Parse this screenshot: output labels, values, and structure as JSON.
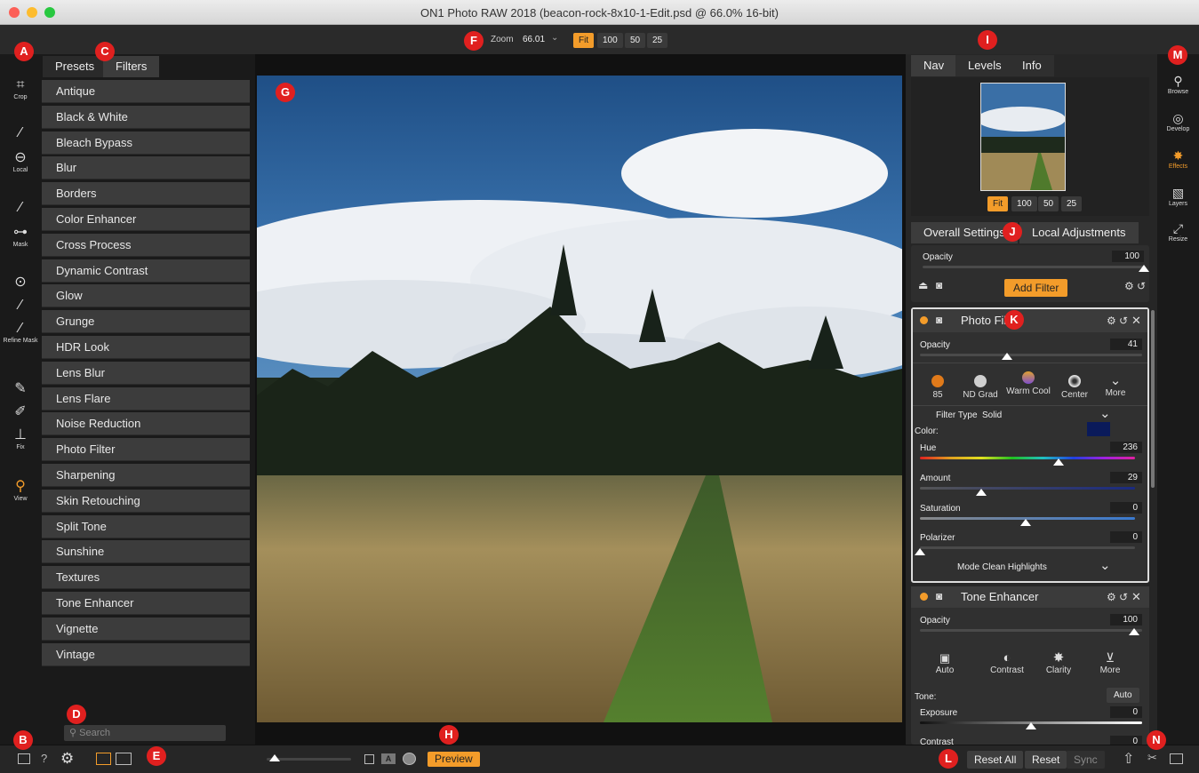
{
  "window": {
    "title": "ON1 Photo RAW 2018 (beacon-rock-8x10-1-Edit.psd @ 66.0% 16-bit)"
  },
  "toolbar": {
    "zoom_label": "Zoom",
    "zoom_value": "66.01",
    "zoom_buttons": [
      "Fit",
      "100",
      "50",
      "25"
    ],
    "active_zoom": "Fit"
  },
  "badges": [
    "A",
    "B",
    "C",
    "D",
    "E",
    "F",
    "G",
    "H",
    "I",
    "J",
    "K",
    "L",
    "M",
    "N"
  ],
  "left_tools": [
    {
      "icon": "crop-icon",
      "glyph": "⌗",
      "label": "Crop"
    },
    {
      "icon": "brush-icon",
      "glyph": "⁄",
      "label": ""
    },
    {
      "icon": "gradient-icon",
      "glyph": "⊖",
      "label": "Local"
    },
    {
      "icon": "masking-brush-icon",
      "glyph": "⁄",
      "label": ""
    },
    {
      "icon": "mask-gradient-icon",
      "glyph": "⊶",
      "label": "Mask"
    },
    {
      "icon": "masking-bug-icon",
      "glyph": "⊙",
      "label": ""
    },
    {
      "icon": "refine-brush-icon",
      "glyph": "⁄",
      "label": ""
    },
    {
      "icon": "chisel-icon",
      "glyph": "⁄",
      "label": "Refine Mask"
    },
    {
      "icon": "retouch-icon",
      "glyph": "✎",
      "label": ""
    },
    {
      "icon": "clone-icon",
      "glyph": "✐",
      "label": ""
    },
    {
      "icon": "stamp-icon",
      "glyph": "⊥",
      "label": "Fix"
    },
    {
      "icon": "zoom-icon",
      "glyph": "⚲",
      "label": "View"
    }
  ],
  "left_panel": {
    "tabs": [
      "Presets",
      "Filters"
    ],
    "active_tab": "Filters",
    "filters": [
      "Antique",
      "Black & White",
      "Bleach Bypass",
      "Blur",
      "Borders",
      "Color Enhancer",
      "Cross Process",
      "Dynamic Contrast",
      "Glow",
      "Grunge",
      "HDR Look",
      "Lens Blur",
      "Lens Flare",
      "Noise Reduction",
      "Photo Filter",
      "Sharpening",
      "Skin Retouching",
      "Split Tone",
      "Sunshine",
      "Textures",
      "Tone Enhancer",
      "Vignette",
      "Vintage"
    ],
    "search_placeholder": "Search"
  },
  "bottom": {
    "preview_label": "Preview",
    "reset_all": "Reset All",
    "reset": "Reset",
    "sync": "Sync"
  },
  "right_panel": {
    "nav_tabs": [
      "Nav",
      "Levels",
      "Info"
    ],
    "nav_zoom_buttons": [
      "Fit",
      "100",
      "50",
      "25"
    ],
    "settings_tabs": [
      "Overall Settings",
      "Local Adjustments"
    ],
    "overall": {
      "opacity_label": "Opacity",
      "opacity": "100",
      "add_filter": "Add Filter"
    },
    "photo_filter": {
      "title": "Photo Filter",
      "opacity_label": "Opacity",
      "opacity": "41",
      "presets": [
        {
          "name": "85",
          "color": "#e07a1a"
        },
        {
          "name": "ND Grad",
          "color": "#cfcfcf"
        },
        {
          "name": "Warm Cool",
          "color": "#8a5fd0"
        },
        {
          "name": "Center",
          "color": "#e0e0e0"
        },
        {
          "name": "More",
          "color": "#333333"
        }
      ],
      "filter_type_label": "Filter Type",
      "filter_type": "Solid",
      "color_label": "Color:",
      "color_swatch": "#0a1a5a",
      "hue_label": "Hue",
      "hue": "236",
      "amount_label": "Amount",
      "amount": "29",
      "saturation_label": "Saturation",
      "saturation": "0",
      "polarizer_label": "Polarizer",
      "polarizer": "0",
      "mode_label": "Mode",
      "mode": "Clean Highlights"
    },
    "tone_enhancer": {
      "title": "Tone Enhancer",
      "opacity_label": "Opacity",
      "opacity": "100",
      "presets": [
        "Auto",
        "Contrast",
        "Clarity",
        "More"
      ],
      "tone_label": "Tone:",
      "auto_button": "Auto",
      "exposure_label": "Exposure",
      "exposure": "0",
      "contrast_label": "Contrast",
      "contrast": "0"
    }
  },
  "modules": [
    {
      "icon": "browse-icon",
      "glyph": "⚲",
      "label": "Browse",
      "active": false
    },
    {
      "icon": "develop-icon",
      "glyph": "◎",
      "label": "Develop",
      "active": false
    },
    {
      "icon": "effects-icon",
      "glyph": "✸",
      "label": "Effects",
      "active": true
    },
    {
      "icon": "layers-icon",
      "glyph": "▧",
      "label": "Layers",
      "active": false
    },
    {
      "icon": "resize-icon",
      "glyph": "⤢",
      "label": "Resize",
      "active": false
    }
  ],
  "colors": {
    "accent": "#f39c2a",
    "badge": "#e0201f"
  }
}
